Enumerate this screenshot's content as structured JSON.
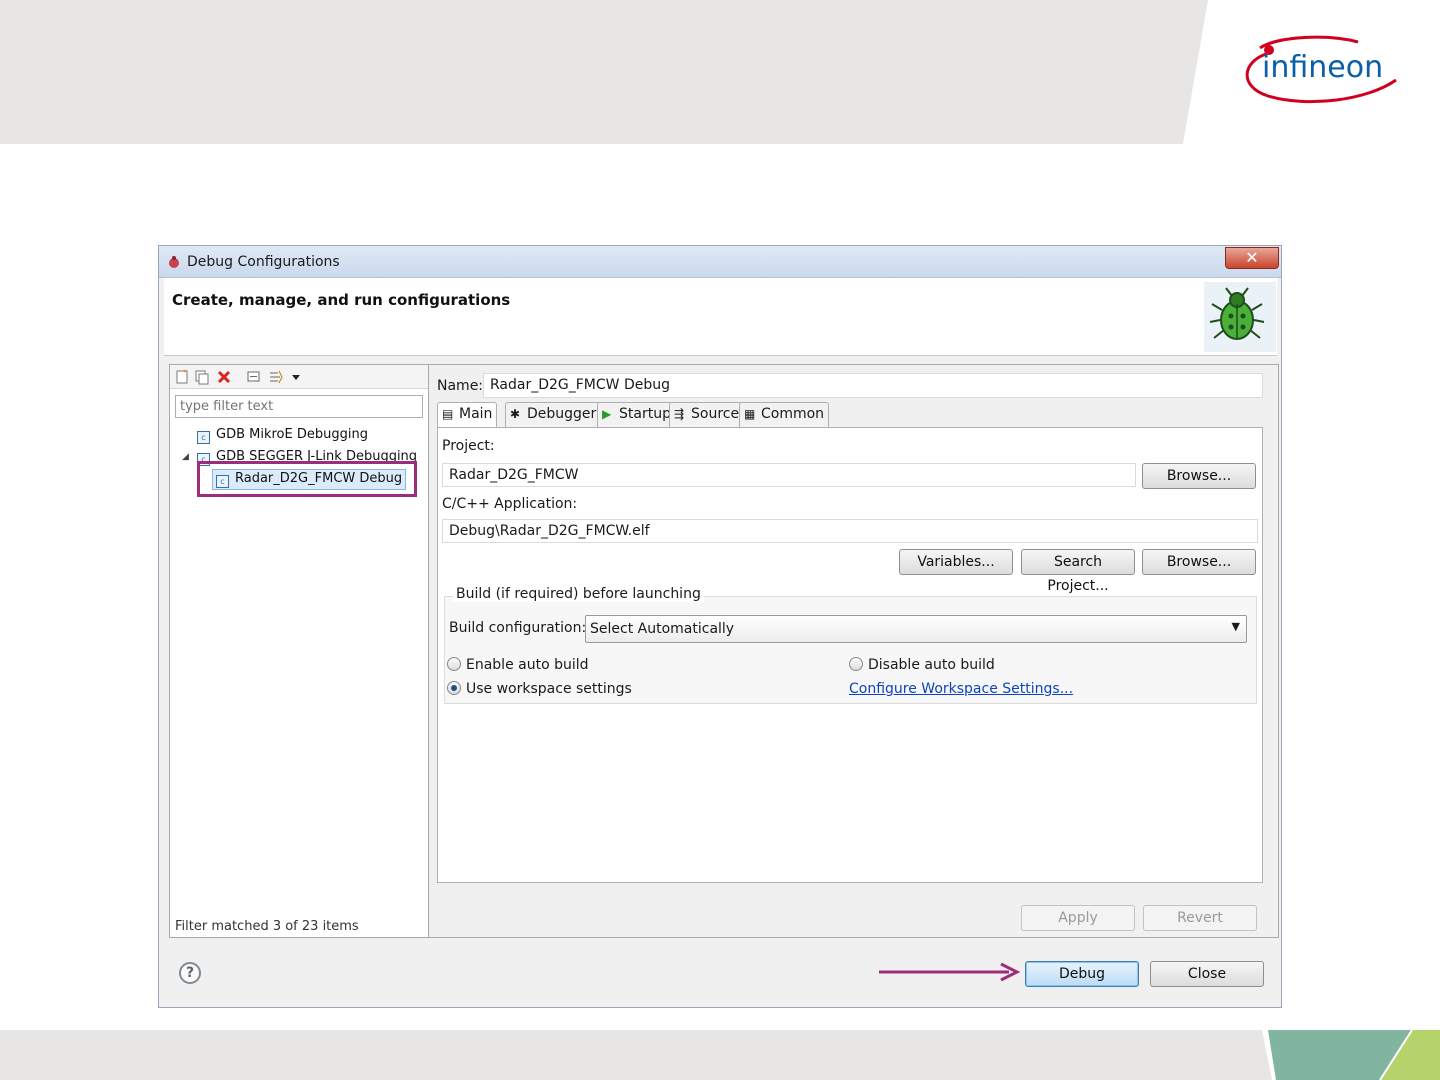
{
  "slide": {
    "brand": "infineon",
    "colors": {
      "top_band": "#e8e5e5",
      "bottom_band": "#e8e5e5",
      "brand_blue": "#0b5ea8",
      "brand_red": "#d1001f",
      "highlight": "#9d2c7a",
      "corner_green": "#82b59f"
    }
  },
  "dialog": {
    "title": "Debug Configurations",
    "close_icon": "close-icon",
    "header_title": "Create, manage, and run configurations",
    "header_icon": "bug-icon",
    "left": {
      "toolbar_icons": [
        "new-config-icon",
        "duplicate-icon",
        "delete-icon",
        "collapse-all-icon",
        "filter-icon",
        "dropdown-icon"
      ],
      "filter_placeholder": "type filter text",
      "tree": [
        {
          "label": "GDB MikroE Debugging",
          "icon": "c-config-icon"
        },
        {
          "label": "GDB SEGGER J-Link Debugging",
          "icon": "c-config-icon",
          "expanded": true
        },
        {
          "label": "Radar_D2G_FMCW Debug",
          "icon": "c-config-icon",
          "selected": true
        }
      ],
      "filter_status": "Filter matched 3 of 23 items"
    },
    "right": {
      "name_label": "Name:",
      "name_value": "Radar_D2G_FMCW Debug",
      "tabs": [
        {
          "label": "Main",
          "icon": "main-tab-icon",
          "active": true
        },
        {
          "label": "Debugger",
          "icon": "debugger-tab-icon"
        },
        {
          "label": "Startup",
          "icon": "startup-tab-icon"
        },
        {
          "label": "Source",
          "icon": "source-tab-icon"
        },
        {
          "label": "Common",
          "icon": "common-tab-icon"
        }
      ],
      "project_label": "Project:",
      "project_value": "Radar_D2G_FMCW",
      "browse_label": "Browse...",
      "app_label": "C/C++ Application:",
      "app_value": "Debug\\Radar_D2G_FMCW.elf",
      "variables_label": "Variables...",
      "search_project_label": "Search Project...",
      "browse2_label": "Browse...",
      "build_group_title": "Build (if required) before launching",
      "build_config_label": "Build configuration:",
      "build_config_value": "Select Automatically",
      "enable_auto_build": "Enable auto build",
      "disable_auto_build": "Disable auto build",
      "use_workspace": "Use workspace settings",
      "configure_link": "Configure Workspace Settings...",
      "selected_build_option": "Use workspace settings",
      "apply_label": "Apply",
      "revert_label": "Revert"
    },
    "footer": {
      "help_icon": "help-icon",
      "debug_label": "Debug",
      "close_label": "Close"
    }
  }
}
